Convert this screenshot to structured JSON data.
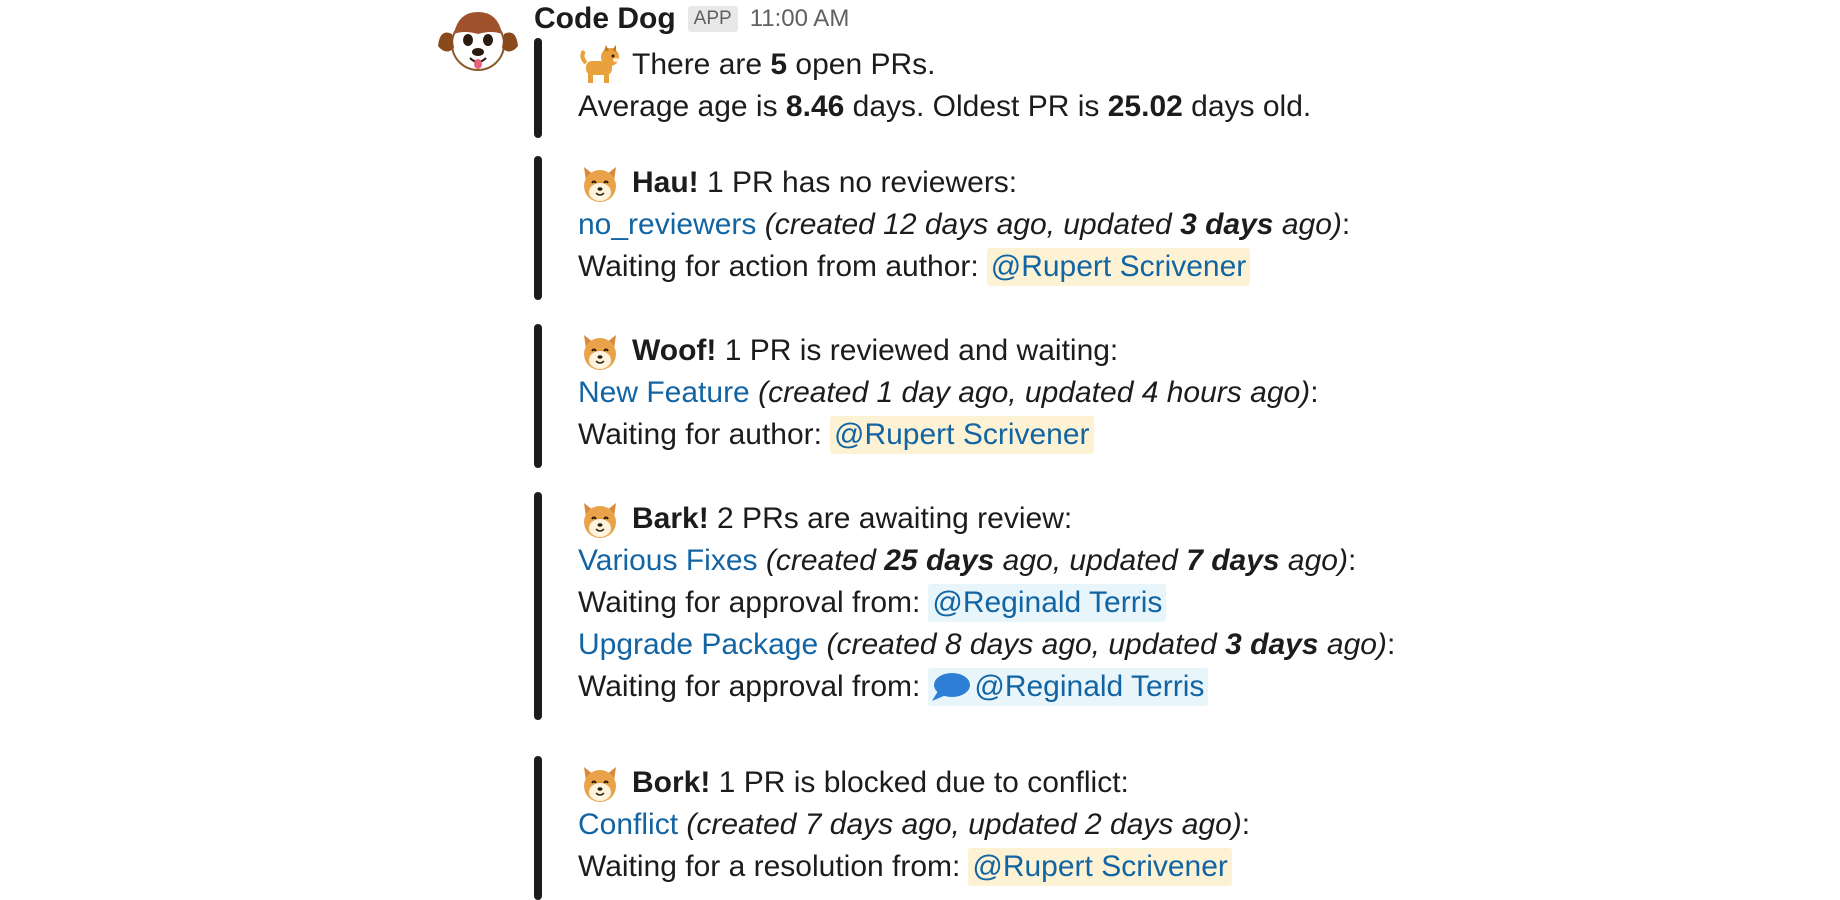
{
  "message": {
    "sender": "Code Dog",
    "badge": "APP",
    "time": "11:00 AM"
  },
  "summary": {
    "l1_prefix": "There are ",
    "l1_count": "5",
    "l1_suffix": " open PRs.",
    "l2_prefix": "Average age is ",
    "l2_avg": "8.46",
    "l2_mid": " days. Oldest PR is ",
    "l2_oldest": "25.02",
    "l2_suffix": " days old."
  },
  "sections": [
    {
      "exclaim": "Hau!",
      "text": " 1 PR has no reviewers:",
      "prs": [
        {
          "title": "no_reviewers",
          "meta_open": " (created ",
          "created": "12 days",
          "meta_mid": " ago, updated ",
          "updated": "3 days",
          "meta_close": " ago)",
          "colon": ":",
          "wait_label": "Waiting for action from author:",
          "mention": "@Rupert Scrivener"
        }
      ]
    },
    {
      "exclaim": "Woof!",
      "text": " 1 PR is reviewed and waiting:",
      "prs": [
        {
          "title": "New Feature",
          "meta_open": " (created ",
          "created": "1 day",
          "meta_mid": " ago, updated ",
          "updated": "4 hours",
          "meta_close": " ago)",
          "colon": ":",
          "wait_label": "Waiting for author:",
          "mention": "@Rupert Scrivener"
        }
      ]
    },
    {
      "exclaim": "Bark!",
      "text": " 2 PRs are awaiting review:",
      "prs": [
        {
          "title": "Various Fixes",
          "meta_open": " (created ",
          "created": "25 days",
          "meta_mid": " ago, updated ",
          "updated": "7 days",
          "meta_close": " ago)",
          "colon": ":",
          "wait_label": "Waiting for approval from:",
          "mention": "@Reginald Terris"
        },
        {
          "title": "Upgrade Package",
          "meta_open": " (created ",
          "created": "8 days",
          "meta_mid": " ago, updated ",
          "updated": "3 days",
          "meta_close": " ago)",
          "colon": ":",
          "wait_label": "Waiting for approval from:",
          "mention": "@Reginald Terris"
        }
      ]
    },
    {
      "exclaim": "Bork!",
      "text": " 1 PR is blocked due to conflict:",
      "prs": [
        {
          "title": "Conflict",
          "meta_open": " (created ",
          "created": "7 days",
          "meta_mid": " ago, updated ",
          "updated": "2 days",
          "meta_close": " ago)",
          "colon": ":",
          "wait_label": "Waiting for a resolution from:",
          "mention": "@Rupert Scrivener"
        }
      ]
    }
  ],
  "icons": {
    "avatar": "dog-face-avatar",
    "summary_emoji": "dog-emoji",
    "section_emoji": "shiba-face-emoji",
    "comment_indicator": "speech-bubble-icon"
  },
  "colors": {
    "link": "#1264a3",
    "mention_bg": "#fdf3d4",
    "mention_reviewer_bg": "#e8f5fa",
    "attachment_bar": "#1d1c1d"
  }
}
